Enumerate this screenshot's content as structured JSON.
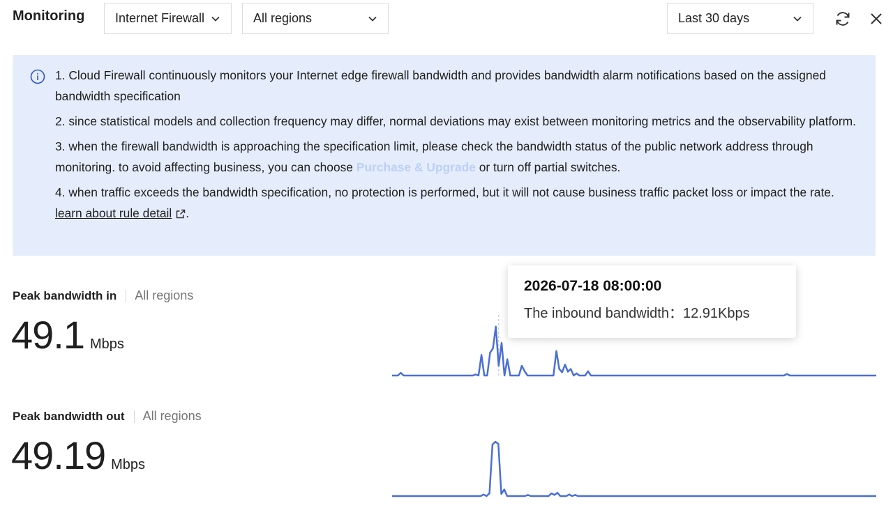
{
  "header": {
    "title": "Monitoring",
    "product_select": "Internet Firewall",
    "region_select": "All regions",
    "range_select": "Last 30 days"
  },
  "notice": {
    "line1": "1. Cloud Firewall continuously monitors your Internet edge firewall bandwidth and provides bandwidth alarm notifications based on the assigned bandwidth specification",
    "line2": "2. since statistical models and collection frequency may differ, normal deviations may exist between monitoring metrics and the observability platform.",
    "line3_pre": "3. when the firewall bandwidth is approaching the specification limit, please check the bandwidth status of the public network address through monitoring. to avoid affecting business, you can choose ",
    "line3_link": "Purchase & Upgrade",
    "line3_post": " or turn off partial switches.",
    "line4": "4. when traffic exceeds the bandwidth specification, no protection is performed, but it will not cause business traffic packet loss or impact the rate.",
    "rule_link": "learn about rule detail",
    "rule_suffix": "."
  },
  "metrics": {
    "in": {
      "label": "Peak bandwidth in",
      "region": "All regions",
      "value": "49.1",
      "unit": "Mbps"
    },
    "out": {
      "label": "Peak bandwidth out",
      "region": "All regions",
      "value": "49.19",
      "unit": "Mbps"
    }
  },
  "tooltip": {
    "date": "2026-07-18 08:00:00",
    "label": "The inbound bandwidth：",
    "value": "12.91Kbps"
  },
  "colors": {
    "accent": "#4a6fd6",
    "notice_bg": "#e5edfc",
    "link": "#bcd0f7"
  },
  "chart_data": [
    {
      "type": "line",
      "series": [
        {
          "values": [
            0,
            0,
            0,
            0.05,
            0,
            0,
            0,
            0,
            0,
            0,
            0,
            0,
            0,
            0,
            0,
            0,
            0,
            0,
            0,
            0,
            0,
            0,
            0,
            0,
            0,
            0,
            0,
            0,
            0,
            0.02,
            0,
            0.38,
            0,
            0,
            0.42,
            0.5,
            0.9,
            0.18,
            0.6,
            0,
            0.3,
            0,
            0,
            0,
            0,
            0.18,
            0.08,
            0,
            0,
            0,
            0,
            0,
            0,
            0,
            0,
            0,
            0,
            0.45,
            0.12,
            0.06,
            0.2,
            0.07,
            0.12,
            0,
            0.04,
            0,
            0,
            0,
            0.08,
            0,
            0,
            0,
            0,
            0,
            0,
            0,
            0,
            0,
            0,
            0,
            0,
            0,
            0,
            0,
            0,
            0,
            0,
            0,
            0,
            0,
            0,
            0,
            0,
            0,
            0,
            0,
            0,
            0,
            0,
            0,
            0,
            0,
            0,
            0,
            0,
            0,
            0,
            0,
            0,
            0,
            0,
            0,
            0,
            0,
            0,
            0,
            0,
            0,
            0,
            0,
            0,
            0,
            0,
            0,
            0,
            0,
            0,
            0,
            0,
            0,
            0,
            0,
            0,
            0,
            0,
            0,
            0,
            0.03,
            0,
            0,
            0,
            0,
            0,
            0,
            0,
            0,
            0,
            0,
            0,
            0,
            0,
            0,
            0,
            0,
            0,
            0,
            0,
            0,
            0,
            0,
            0,
            0,
            0,
            0,
            0,
            0,
            0,
            0,
            0
          ]
        }
      ],
      "highlight_index": 37
    },
    {
      "type": "line",
      "series": [
        {
          "values": [
            0,
            0,
            0,
            0,
            0,
            0,
            0,
            0,
            0,
            0,
            0,
            0,
            0,
            0,
            0,
            0,
            0,
            0,
            0,
            0,
            0,
            0,
            0,
            0,
            0,
            0,
            0,
            0,
            0,
            0,
            0,
            0.03,
            0,
            0.05,
            0.95,
            1,
            0.96,
            0.04,
            0.12,
            0,
            0,
            0,
            0,
            0,
            0,
            0,
            0.02,
            0,
            0,
            0,
            0,
            0,
            0,
            0,
            0.05,
            0.02,
            0.06,
            0,
            0,
            0,
            0.03,
            0,
            0.02,
            0,
            0,
            0,
            0,
            0,
            0,
            0,
            0,
            0,
            0,
            0,
            0,
            0,
            0,
            0,
            0,
            0,
            0,
            0,
            0,
            0,
            0,
            0,
            0,
            0,
            0,
            0,
            0,
            0,
            0,
            0,
            0,
            0,
            0,
            0,
            0,
            0,
            0,
            0,
            0,
            0,
            0,
            0,
            0,
            0,
            0,
            0,
            0,
            0,
            0,
            0,
            0,
            0,
            0,
            0,
            0,
            0,
            0,
            0,
            0,
            0,
            0,
            0,
            0,
            0,
            0,
            0,
            0,
            0,
            0,
            0,
            0,
            0,
            0,
            0,
            0,
            0,
            0,
            0,
            0,
            0,
            0,
            0,
            0,
            0,
            0,
            0,
            0,
            0,
            0,
            0,
            0,
            0,
            0,
            0,
            0,
            0,
            0,
            0,
            0,
            0,
            0
          ]
        }
      ]
    }
  ]
}
